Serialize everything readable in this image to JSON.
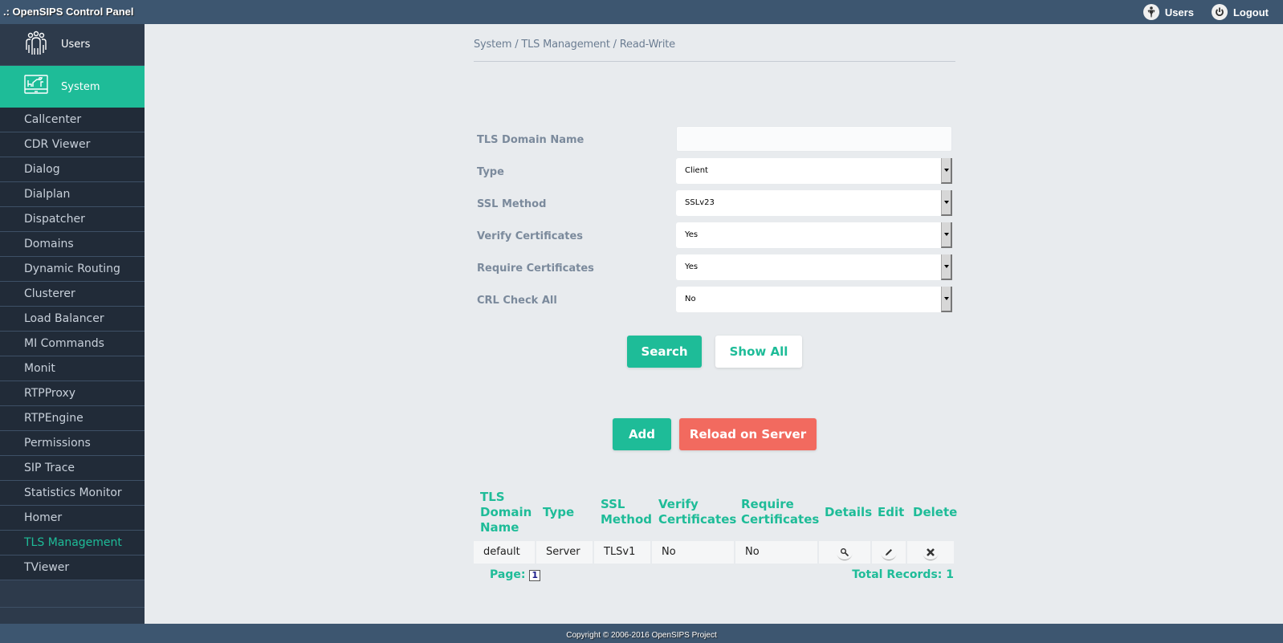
{
  "header": {
    "title": ".: OpenSIPS Control Panel",
    "nav": [
      {
        "label": "Users",
        "icon": "user-icon"
      },
      {
        "label": "Logout",
        "icon": "power-icon"
      }
    ]
  },
  "sidebar": {
    "main_items": [
      {
        "label": "Users",
        "icon": "users-group-icon"
      },
      {
        "label": "System",
        "icon": "system-monitor-icon",
        "active": true
      }
    ],
    "sub_items": [
      {
        "label": "Callcenter"
      },
      {
        "label": "CDR Viewer"
      },
      {
        "label": "Dialog"
      },
      {
        "label": "Dialplan"
      },
      {
        "label": "Dispatcher"
      },
      {
        "label": "Domains"
      },
      {
        "label": "Dynamic Routing"
      },
      {
        "label": "Clusterer"
      },
      {
        "label": "Load Balancer"
      },
      {
        "label": "MI Commands"
      },
      {
        "label": "Monit"
      },
      {
        "label": "RTPProxy"
      },
      {
        "label": "RTPEngine"
      },
      {
        "label": "Permissions"
      },
      {
        "label": "SIP Trace"
      },
      {
        "label": "Statistics Monitor"
      },
      {
        "label": "Homer"
      },
      {
        "label": "TLS Management",
        "active": true
      },
      {
        "label": "TViewer"
      }
    ]
  },
  "breadcrumb": {
    "items": [
      "System",
      "TLS Management",
      "Read-Write"
    ],
    "separator": " / "
  },
  "form": {
    "domain_name": {
      "label": "TLS Domain Name",
      "value": ""
    },
    "type": {
      "label": "Type",
      "value": "Client"
    },
    "ssl_method": {
      "label": "SSL Method",
      "value": "SSLv23"
    },
    "verify_certificates": {
      "label": "Verify Certificates",
      "value": "Yes"
    },
    "require_certificates": {
      "label": "Require Certificates",
      "value": "Yes"
    },
    "crl_check_all": {
      "label": "CRL Check All",
      "value": "No"
    }
  },
  "buttons": {
    "search": "Search",
    "show_all": "Show All",
    "add": "Add",
    "reload": "Reload on Server"
  },
  "colors": {
    "accent": "#1ebc98",
    "danger": "#f26a5f",
    "header_bg": "#3d5670",
    "sidebar_bg": "#212b38"
  },
  "table": {
    "columns": [
      "TLS Domain Name",
      "Type",
      "SSL Method",
      "Verify Certificates",
      "Require Certificates",
      "Details",
      "Edit",
      "Delete"
    ],
    "rows": [
      {
        "domain": "default",
        "type": "Server",
        "ssl_method": "TLSv1",
        "verify": "No",
        "require": "No"
      }
    ],
    "page_label": "Page:",
    "current_page": "1",
    "total_records": "Total Records: 1"
  },
  "footer": {
    "copyright": "Copyright © 2006-2016 OpenSIPS Project"
  }
}
